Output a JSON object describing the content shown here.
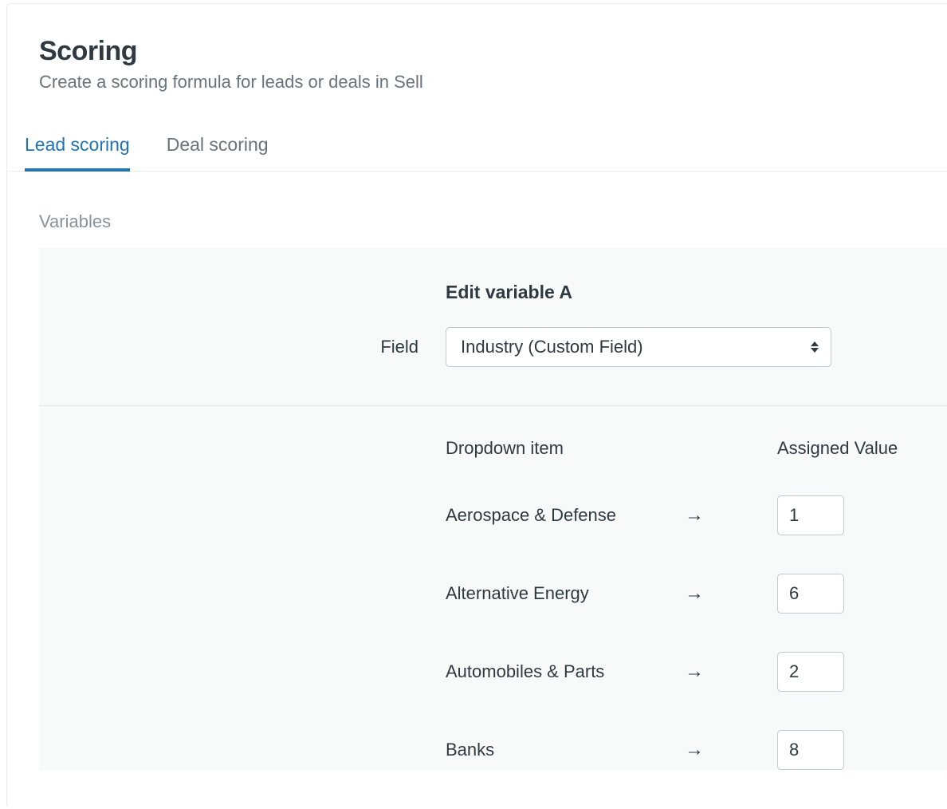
{
  "header": {
    "title": "Scoring",
    "subtitle": "Create a scoring formula for leads or deals in Sell"
  },
  "tabs": [
    {
      "label": "Lead scoring",
      "active": true
    },
    {
      "label": "Deal scoring",
      "active": false
    }
  ],
  "section": {
    "label": "Variables"
  },
  "variable": {
    "title": "Edit variable A",
    "field_label": "Field",
    "field_value": "Industry (Custom Field)",
    "columns": {
      "item": "Dropdown item",
      "value": "Assigned Value"
    },
    "arrow": "→",
    "rows": [
      {
        "label": "Aerospace & Defense",
        "value": "1"
      },
      {
        "label": "Alternative Energy",
        "value": "6"
      },
      {
        "label": "Automobiles & Parts",
        "value": "2"
      },
      {
        "label": "Banks",
        "value": "8"
      }
    ]
  }
}
